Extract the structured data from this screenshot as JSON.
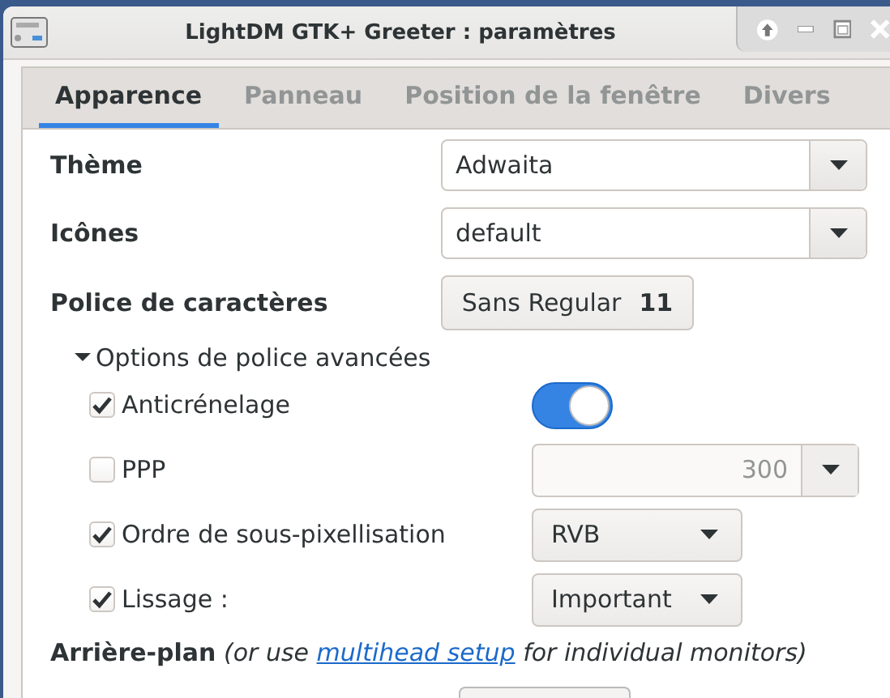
{
  "window": {
    "title": "LightDM GTK+ Greeter : paramètres"
  },
  "tabs": [
    {
      "label": "Apparence",
      "selected": true
    },
    {
      "label": "Panneau",
      "selected": false
    },
    {
      "label": "Position de la fenêtre",
      "selected": false
    },
    {
      "label": "Divers",
      "selected": false
    }
  ],
  "settings": [
    {
      "kind": "combo",
      "label": "Thème",
      "value": "Adwaita"
    },
    {
      "kind": "combo",
      "label": "Icônes",
      "value": "default"
    },
    {
      "kind": "font",
      "label": "Police de caractères",
      "font_name": "Sans Regular",
      "font_size": "11"
    }
  ],
  "advanced": {
    "label": "Options de police avancées",
    "expanded": true,
    "options": [
      {
        "kind": "switch",
        "label": "Anticrénelage",
        "checked": true,
        "on": true
      },
      {
        "kind": "spin",
        "label": "PPP",
        "checked": false,
        "value": "300"
      },
      {
        "kind": "dropdown",
        "label": "Ordre de sous-pixellisation",
        "checked": true,
        "value": "RVB"
      },
      {
        "kind": "dropdown",
        "label": "Lissage :",
        "checked": true,
        "value": "Important"
      }
    ]
  },
  "background": {
    "label": "Arrière-plan",
    "note_before": "(or use",
    "link": "multihead setup",
    "note_after": "for individual monitors)"
  }
}
